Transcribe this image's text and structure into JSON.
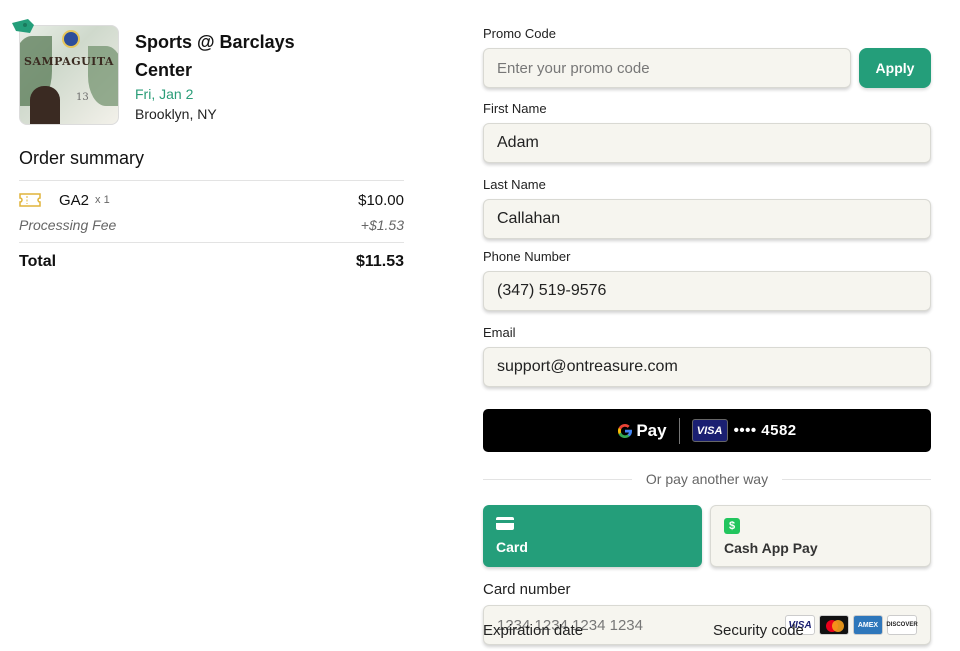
{
  "event": {
    "title": "Sports @ Barclays Center",
    "date": "Fri, Jan 2",
    "location": "Brooklyn, NY",
    "image_title": "SAMPAGUITA",
    "image_number": "13"
  },
  "order": {
    "title": "Order summary",
    "item_name": "GA2",
    "item_qty": "x 1",
    "item_price": "$10.00",
    "fee_label": "Processing Fee",
    "fee_value": "+$1.53",
    "total_label": "Total",
    "total_value": "$11.53"
  },
  "form": {
    "promo_label": "Promo Code",
    "promo_placeholder": "Enter your promo code",
    "apply_label": "Apply",
    "first_name_label": "First Name",
    "first_name_value": "Adam",
    "last_name_label": "Last Name",
    "last_name_value": "Callahan",
    "phone_label": "Phone Number",
    "phone_value": "(347) 519-9576",
    "email_label": "Email",
    "email_value": "support@ontreasure.com"
  },
  "payment": {
    "gpay_label": "Pay",
    "gpay_card_brand": "VISA",
    "gpay_card_last": "•••• 4582",
    "or_text": "Or pay another way",
    "method_card": "Card",
    "method_cash": "Cash App Pay",
    "card_number_label": "Card number",
    "card_number_placeholder": "1234 1234 1234 1234",
    "brands": [
      "VISA",
      "Mastercard",
      "AMEX",
      "DISCOVER"
    ],
    "expiration_label": "Expiration date",
    "security_label": "Security code"
  },
  "colors": {
    "accent": "#249e7a",
    "field_bg": "#f6f5ef",
    "gpay_bg": "#000000"
  }
}
